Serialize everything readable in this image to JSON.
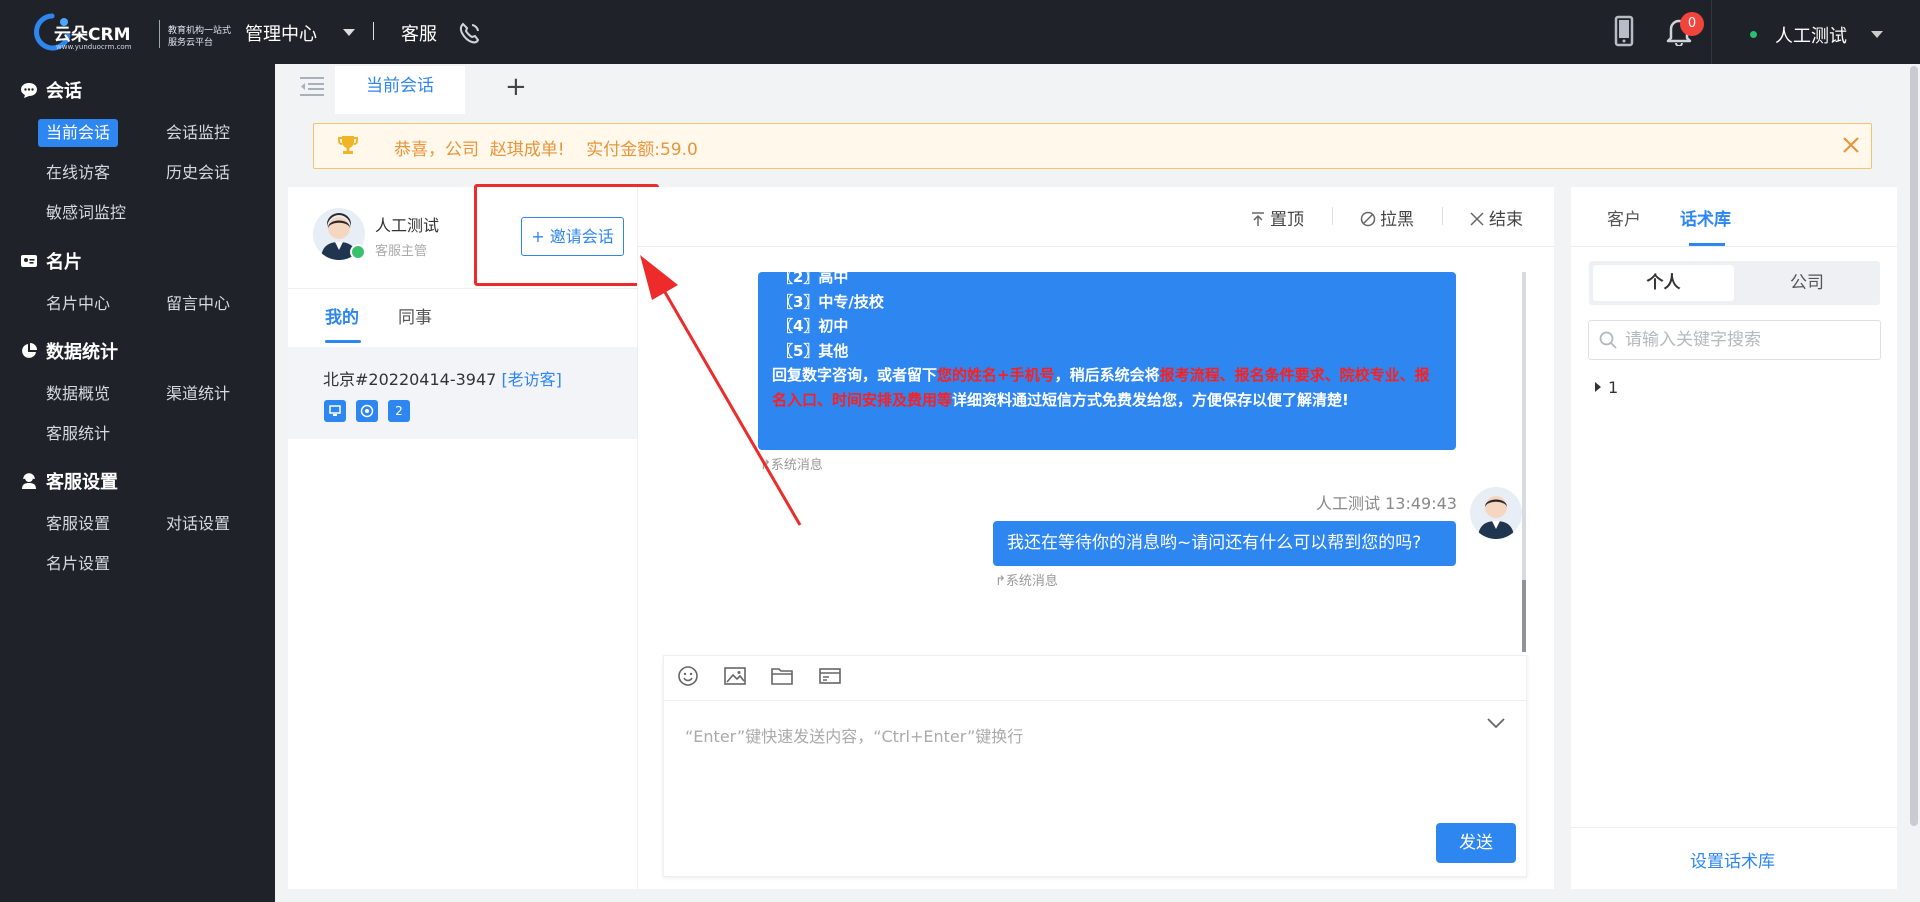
{
  "header": {
    "brand": "云朵CRM",
    "brand_url": "www.yunduocrm.com",
    "slogan": "教育机构一站式服务云平台",
    "nav_admin": "管理中心",
    "nav_kefu": "客服",
    "notification_count": "0",
    "user_name": "人工测试"
  },
  "sidebar": {
    "groups": [
      {
        "label": "会话",
        "icon": "chat-bubble-icon"
      },
      {
        "label": "名片",
        "icon": "id-card-icon"
      },
      {
        "label": "数据统计",
        "icon": "pie-chart-icon"
      },
      {
        "label": "客服设置",
        "icon": "agent-icon"
      }
    ],
    "items": {
      "current_session": "当前会话",
      "session_monitor": "会话监控",
      "online_visitors": "在线访客",
      "history_sessions": "历史会话",
      "sensitive_monitor": "敏感词监控",
      "card_center": "名片中心",
      "message_center": "留言中心",
      "data_overview": "数据概览",
      "channel_stats": "渠道统计",
      "agent_stats": "客服统计",
      "agent_settings": "客服设置",
      "dialog_settings": "对话设置",
      "card_settings": "名片设置"
    }
  },
  "tabs": {
    "current": "当前会话",
    "add": "+"
  },
  "banner": {
    "text": "恭喜，公司  赵琪成单!    实付金额:59.0",
    "accent": "#e8953b"
  },
  "left_panel": {
    "agent_name": "人工测试",
    "agent_role": "客服主管",
    "invite_button": "+ 邀请会话",
    "tab_mine": "我的",
    "tab_colleague": "同事",
    "session": {
      "name": "北京#20220414-3947 ",
      "tag": "[老访客]",
      "count": "2"
    }
  },
  "chat": {
    "actions": {
      "pin": "置顶",
      "block": "拉黑",
      "end": "结束"
    },
    "system_bubble": {
      "options": [
        "〖2〗高中",
        "〖3〗中专/技校",
        "〖4〗初中",
        "〖5〗其他"
      ],
      "line1": "回复数字咨询，或者留下",
      "red1": "您的姓名+手机号",
      "line2": "，稍后系统会将",
      "red2": "报考流程、报名条件要求、院校专业、报名入口、时间安排及费用等",
      "line3": "详细资料通过短信方式免费发给您，方便保存以便了解清楚!"
    },
    "system_label": "系统消息",
    "message_meta": "人工测试 13:49:43",
    "message_text": "我还在等待你的消息哟~请问还有什么可以帮到您的吗?",
    "composer_placeholder": "“Enter”键快速发送内容，“Ctrl+Enter”键换行",
    "send_button": "发送"
  },
  "right_panel": {
    "tab_customer": "客户",
    "tab_library": "话术库",
    "seg_personal": "个人",
    "seg_company": "公司",
    "search_placeholder": "请输入关键字搜索",
    "tree_item": "1",
    "setup_link": "设置话术库"
  },
  "colors": {
    "primary": "#2e86f0",
    "sidebar_bg": "#20222a",
    "highlight": "#ee2b2b"
  }
}
